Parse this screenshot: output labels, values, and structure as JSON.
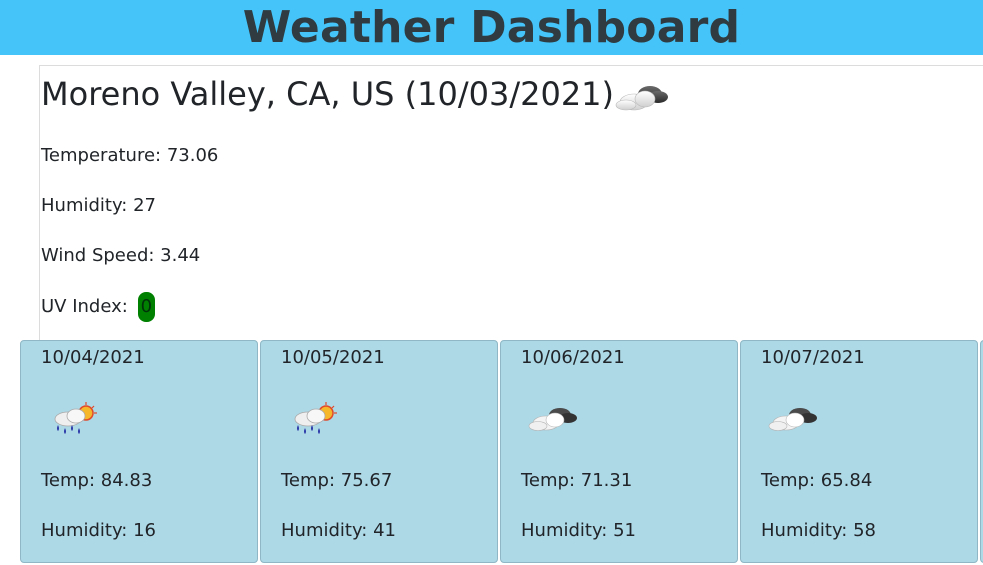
{
  "header": {
    "title": "Weather Dashboard"
  },
  "current": {
    "title": "Moreno Valley, CA, US (10/03/2021)",
    "icon": "cloud-icon",
    "temperature_label": "Temperature: ",
    "temperature_value": "73.06",
    "humidity_label": "Humidity: ",
    "humidity_value": "27",
    "wind_label": "Wind Speed: ",
    "wind_value": "3.44",
    "uv_label": "UV Index: ",
    "uv_value": "0",
    "uv_color": "#008000"
  },
  "forecast": [
    {
      "date": "10/04/2021",
      "icon": "rain-sun-icon",
      "temp_label": "Temp: ",
      "temp": "84.83",
      "humidity_label": "Humidity: ",
      "humidity": "16"
    },
    {
      "date": "10/05/2021",
      "icon": "rain-sun-icon",
      "temp_label": "Temp: ",
      "temp": "75.67",
      "humidity_label": "Humidity: ",
      "humidity": "41"
    },
    {
      "date": "10/06/2021",
      "icon": "cloud-icon",
      "temp_label": "Temp: ",
      "temp": "71.31",
      "humidity_label": "Humidity: ",
      "humidity": "51"
    },
    {
      "date": "10/07/2021",
      "icon": "cloud-icon",
      "temp_label": "Temp: ",
      "temp": "65.84",
      "humidity_label": "Humidity: ",
      "humidity": "58"
    }
  ],
  "colors": {
    "header_bg": "#45c4f9",
    "card_bg": "#add8e6"
  }
}
